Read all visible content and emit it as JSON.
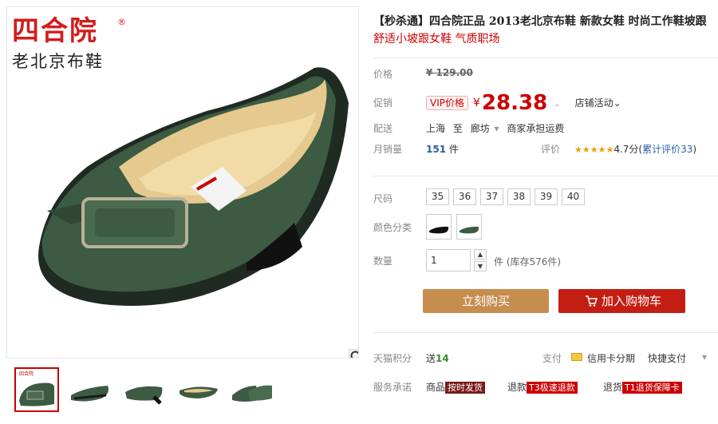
{
  "brand": {
    "name_cn": "四合院",
    "registered": "®",
    "subtitle": "老北京布鞋"
  },
  "title": "【秒杀通】四合院正品 2013老北京布鞋 新款女鞋 时尚工作鞋坡跟",
  "subtitle": "舒适小坡跟女鞋 气质职场",
  "price_row": {
    "label": "价格",
    "original": "¥ 129.00"
  },
  "promo_row": {
    "label": "促销",
    "vip_tag": "VIP价格",
    "currency": "¥",
    "price": "28.38",
    "caret": "⌄",
    "shop_activity": "店铺活动⌄"
  },
  "delivery_row": {
    "label": "配送",
    "from": "上海",
    "to_word": "至",
    "dest": "廊坊",
    "caret": "▾",
    "shipping": "商家承担运费"
  },
  "sales_row": {
    "label": "月销量",
    "count": "151",
    "unit": "件",
    "rating_label": "评价",
    "stars": "★★★★★",
    "rating": "4.7分(",
    "review_link": "累计评价33",
    "close": ")"
  },
  "size_row": {
    "label": "尺码",
    "sizes": [
      "35",
      "36",
      "37",
      "38",
      "39",
      "40"
    ]
  },
  "color_row": {
    "label": "颜色分类"
  },
  "qty_row": {
    "label": "数量",
    "value": "1",
    "stock": "件 (库存576件)"
  },
  "buttons": {
    "buy": "立刻购买",
    "cart": "加入购物车"
  },
  "points_row": {
    "label": "天猫积分",
    "text": "送",
    "value": "14"
  },
  "pay_row": {
    "label": "支付",
    "card": "信用卡分期",
    "quick": "快捷支付",
    "caret": "▾"
  },
  "service_row": {
    "label": "服务承诺",
    "item1_pre": "商品",
    "item1_tag": "按时发货",
    "item2_pre": "退款",
    "item2_tag": "T3极速退款",
    "item3_pre": "退货",
    "item3_tag": "T1退货保障卡"
  },
  "colors": {
    "accent": "#c00",
    "buy": "#c78d4f",
    "cart": "#c41e12",
    "shoe": "#3d5a42"
  }
}
